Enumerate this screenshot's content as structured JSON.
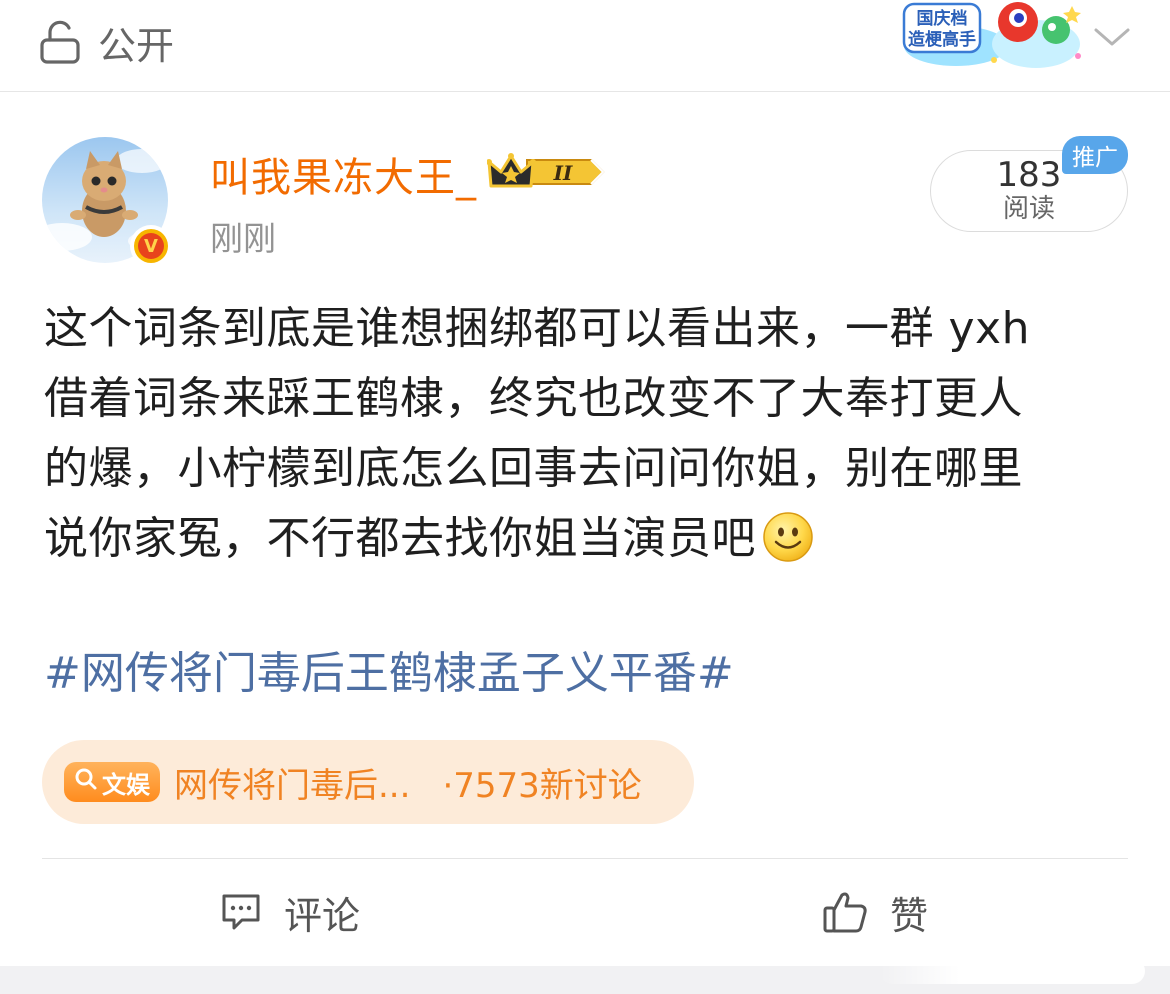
{
  "header": {
    "visibility_label": "公开",
    "lock_icon": "unlock-icon",
    "campaign_badge_text": [
      "国庆档",
      "造梗高手"
    ],
    "chevron_icon": "chevron-down-icon"
  },
  "post": {
    "author": {
      "name": "叫我果冻大王_",
      "crown_badge_text": "II",
      "verified_mark": "V",
      "avatar_icon": "cat-avatar"
    },
    "timestamp": "刚刚",
    "reads": {
      "count": "183",
      "label": "阅读",
      "promo_tag": "推广"
    },
    "body": {
      "lines": [
        "这个词条到底是谁想捆绑都可以看出来，一群 yxh",
        "借着词条来踩王鹤棣，终究也改变不了大奉打更人",
        "的爆，小柠檬到底怎么回事去问问你姐，别在哪里",
        "说你家冤，不行都去找你姐当演员吧"
      ],
      "emoji_icon": "smile-emoji-icon"
    },
    "hashtag": "#网传将门毒后王鹤棣孟子义平番#",
    "topic_card": {
      "chip_label": "文娱",
      "title": "网传将门毒后...",
      "count": "·7573新讨论"
    },
    "actions": {
      "comment_label": "评论",
      "like_label": "赞"
    }
  },
  "colors": {
    "username": "#f26b00",
    "hashtag": "#4e6fa3",
    "topic_bg": "#fdebd9",
    "topic_text": "#f08323",
    "promo_tag": "#58a6ea"
  }
}
